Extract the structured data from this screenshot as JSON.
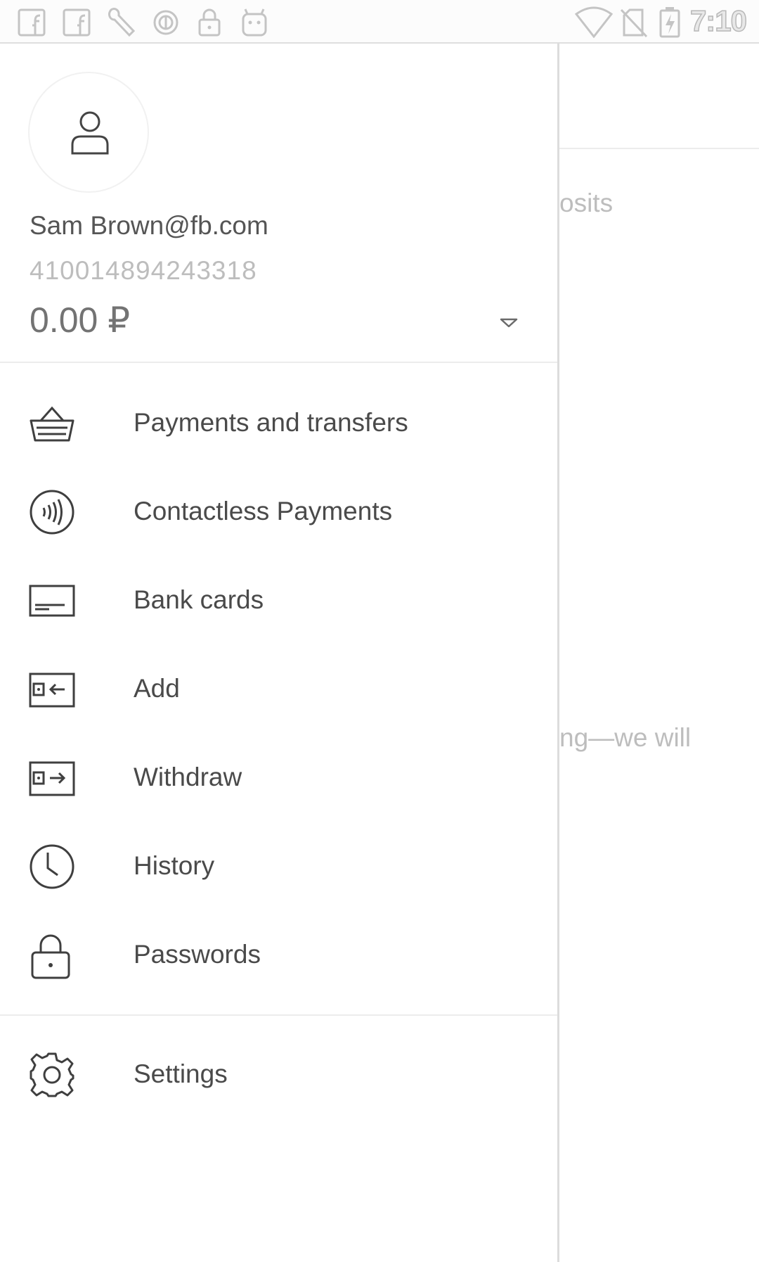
{
  "status_bar": {
    "time": "7:10",
    "icons": [
      "facebook-icon",
      "facebook-icon",
      "wrench-icon",
      "sync-icon",
      "lock-icon",
      "android-icon",
      "wifi-icon",
      "no-sim-icon",
      "battery-charging-icon"
    ]
  },
  "background": {
    "fragment_top": "osits",
    "fragment_mid": "ng—we will"
  },
  "drawer": {
    "account": {
      "email": "Sam Brown@fb.com",
      "number": "410014894243318",
      "balance": "0.00 ₽"
    },
    "menu": [
      {
        "label": "Payments and transfers",
        "icon": "basket-icon"
      },
      {
        "label": "Contactless Payments",
        "icon": "contactless-icon"
      },
      {
        "label": "Bank cards",
        "icon": "bank-card-icon"
      },
      {
        "label": "Add",
        "icon": "add-funds-icon"
      },
      {
        "label": "Withdraw",
        "icon": "withdraw-icon"
      },
      {
        "label": "History",
        "icon": "clock-icon"
      },
      {
        "label": "Passwords",
        "icon": "padlock-icon"
      }
    ],
    "settings": {
      "label": "Settings",
      "icon": "gear-icon"
    }
  },
  "colors": {
    "text_primary": "#4a4a4a",
    "text_secondary": "#bdbdbd",
    "icon_stroke": "#3f3f3f",
    "divider": "#ececec"
  }
}
